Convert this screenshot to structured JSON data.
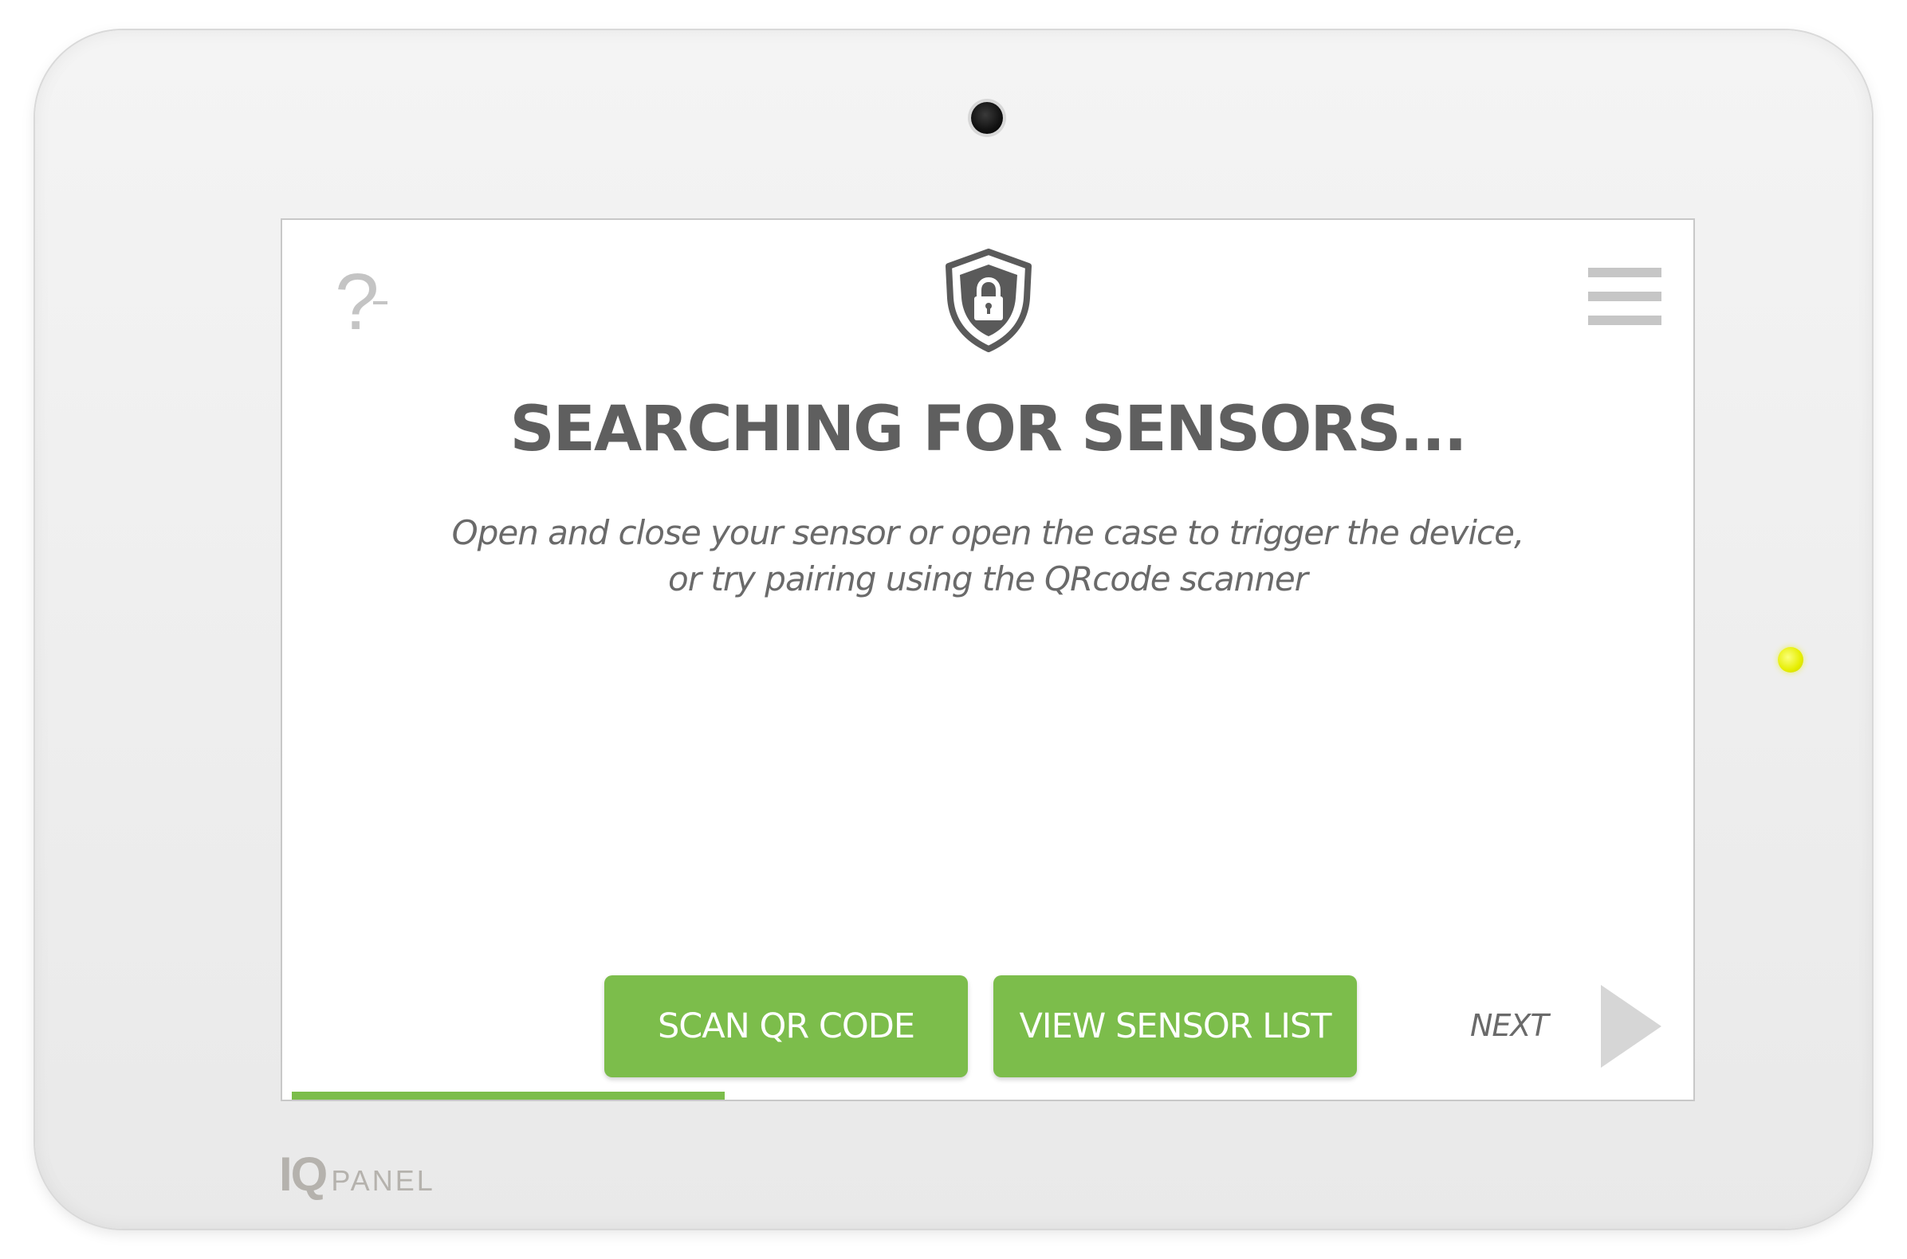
{
  "device": {
    "brand_mark": "IQ",
    "brand_sub": "PANEL",
    "led_color": "#e6ee00"
  },
  "header": {
    "help_icon": "question-mark-icon",
    "help_symbol": "?",
    "center_icon": "shield-lock-icon",
    "menu_icon": "hamburger-menu-icon"
  },
  "main": {
    "title": "SEARCHING FOR SENSORS...",
    "instructions_line1": "Open and close your sensor or open the case to trigger the device,",
    "instructions_line2": "or try pairing using the QRcode scanner"
  },
  "actions": {
    "scan_label": "SCAN QR CODE",
    "list_label": "VIEW SENSOR LIST",
    "next_label": "NEXT",
    "next_icon": "play-arrow-icon"
  },
  "progress": {
    "fraction": 0.31
  },
  "colors": {
    "accent_green": "#7cbd4b",
    "title_gray": "#5f5f5f",
    "icon_gray": "#c6c6c6"
  }
}
